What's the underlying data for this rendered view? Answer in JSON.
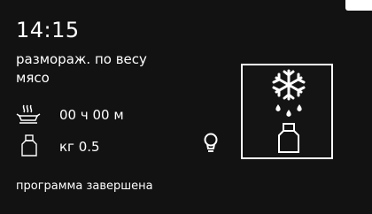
{
  "header": {
    "time": "14:15"
  },
  "program": {
    "name": "размораж. по весу",
    "food": "мясо"
  },
  "settings": {
    "duration": "00 ч 00 м",
    "weight": "кг 0.5"
  },
  "status": {
    "message": "программа завершена"
  },
  "icons": {
    "duration": "cooking-dish-icon",
    "weight": "weight-icon",
    "lamp": "lamp-icon",
    "mode": "defrost-by-weight-icon"
  }
}
